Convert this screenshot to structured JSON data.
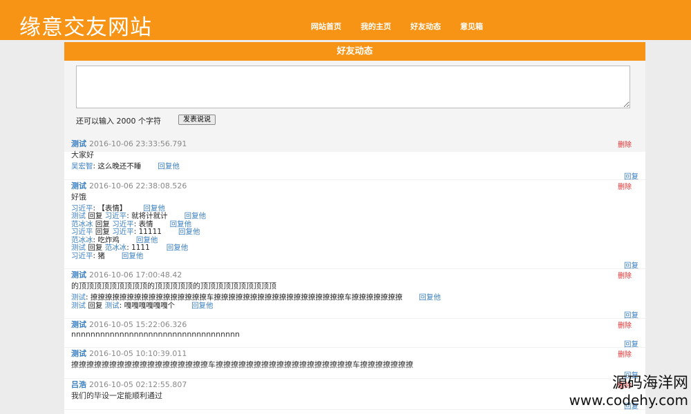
{
  "header": {
    "logo": "缘意交友网站",
    "nav": [
      "网站首页",
      "我的主页",
      "好友动态",
      "意见箱"
    ]
  },
  "panel": {
    "title": "好友动态",
    "remaining_text": "还可以输入 2000 个字符",
    "post_button": "发表说说"
  },
  "labels": {
    "delete": "删除",
    "reply": "回复",
    "reply_him": "回复他"
  },
  "posts": [
    {
      "author": "测试",
      "time": "2016-10-06 23:33:56.791",
      "content": "大家好",
      "comments": [
        {
          "name": "吴宏智",
          "text": ": 这么晚还不睡"
        }
      ]
    },
    {
      "author": "测试",
      "time": "2016-10-06 22:38:08.526",
      "content": "好饿",
      "comments": [
        {
          "name": "习近平",
          "text": ": 【表情】"
        },
        {
          "name": "测试",
          "mid": " 回复 ",
          "target": "习近平",
          "text": ": 就将计就计"
        },
        {
          "name": "范冰冰",
          "mid": " 回复 ",
          "target": "习近平",
          "text": ": 表情"
        },
        {
          "name": "习近平",
          "mid": " 回复 ",
          "target": "习近平",
          "text": ": 11111"
        },
        {
          "name": "范冰冰",
          "text": ": 吃炸鸡"
        },
        {
          "name": "测试",
          "mid": " 回复 ",
          "target": "范冰冰",
          "text": ": 1111"
        },
        {
          "name": "习近平",
          "text": ": 猪"
        }
      ]
    },
    {
      "author": "测试",
      "time": "2016-10-06 17:00:48.42",
      "content": "的顶顶顶顶顶顶顶顶顶的顶顶顶顶顶的顶顶顶顶顶顶顶顶顶顶",
      "comments": [
        {
          "name": "测试",
          "text": ": 撩撩撩撩撩撩撩撩撩撩撩撩撩撩撩撩车撩撩撩撩撩撩撩撩撩撩撩撩撩撩撩撩撩撩车撩撩撩撩撩撩撩"
        },
        {
          "name": "测试",
          "mid": " 回复 ",
          "target": "测试",
          "text": ": 嘎嘎嘎嘎嘎嘎个"
        }
      ]
    },
    {
      "author": "测试",
      "time": "2016-10-05 15:22:06.326",
      "content": "nnnnnnnnnnnnnnnnnnnnnnnnnnnnnnnnnnn",
      "comments": []
    },
    {
      "author": "测试",
      "time": "2016-10-05 10:10:39.011",
      "content": "撩撩撩撩撩撩撩撩撩撩撩撩撩撩撩撩撩撩车撩撩撩撩撩撩撩撩撩撩撩撩撩撩撩撩撩撩车撩撩撩撩撩撩撩",
      "comments": []
    },
    {
      "author": "吕浩",
      "time": "2016-10-05 02:12:55.807",
      "content": "我们的毕设一定能顺利通过",
      "comments": []
    }
  ],
  "watermark": {
    "line1": "源码海洋网",
    "line2": "www.codehy.com"
  }
}
